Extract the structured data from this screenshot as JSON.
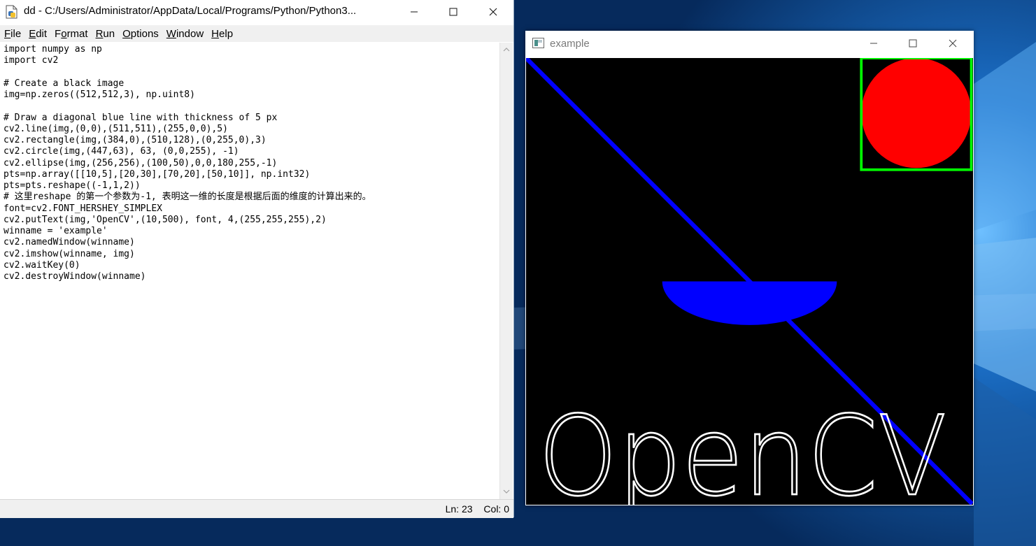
{
  "idle": {
    "title": "dd - C:/Users/Administrator/AppData/Local/Programs/Python/Python3...",
    "menu": [
      {
        "label": "File",
        "key": "F",
        "rest": "ile"
      },
      {
        "label": "Edit",
        "key": "E",
        "rest": "dit"
      },
      {
        "label": "Format",
        "key": "",
        "pre": "F",
        "keymid": "o",
        "rest": "rmat"
      },
      {
        "label": "Run",
        "key": "R",
        "rest": "un"
      },
      {
        "label": "Options",
        "key": "O",
        "rest": "ptions"
      },
      {
        "label": "Window",
        "key": "W",
        "rest": "indow"
      },
      {
        "label": "Help",
        "key": "H",
        "rest": "elp"
      }
    ],
    "code": "import numpy as np\nimport cv2\n\n# Create a black image\nimg=np.zeros((512,512,3), np.uint8)\n\n# Draw a diagonal blue line with thickness of 5 px\ncv2.line(img,(0,0),(511,511),(255,0,0),5)\ncv2.rectangle(img,(384,0),(510,128),(0,255,0),3)\ncv2.circle(img,(447,63), 63, (0,0,255), -1)\ncv2.ellipse(img,(256,256),(100,50),0,0,180,255,-1)\npts=np.array([[10,5],[20,30],[70,20],[50,10]], np.int32)\npts=pts.reshape((-1,1,2))\n# 这里reshape 的第一个参数为-1, 表明这一维的长度是根据后面的维度的计算出来的。\nfont=cv2.FONT_HERSHEY_SIMPLEX\ncv2.putText(img,'OpenCV',(10,500), font, 4,(255,255,255),2)\nwinname = 'example'\ncv2.namedWindow(winname)\ncv2.imshow(winname, img)\ncv2.waitKey(0)\ncv2.destroyWindow(winname)",
    "status": {
      "line": "Ln: 23",
      "col": "Col: 0"
    }
  },
  "cv": {
    "title": "example",
    "image_text": "OpenCV",
    "colors": {
      "background": "#000000",
      "line": "#0000ff",
      "rectangle": "#00ff00",
      "circle": "#ff0000",
      "ellipse": "#0000ff",
      "text": "#ffffff"
    }
  },
  "icons": [
    "idle-file-icon",
    "minimize-icon",
    "maximize-icon",
    "close-icon",
    "window-app-icon",
    "scroll-up-arrow-icon",
    "scroll-down-arrow-icon"
  ]
}
